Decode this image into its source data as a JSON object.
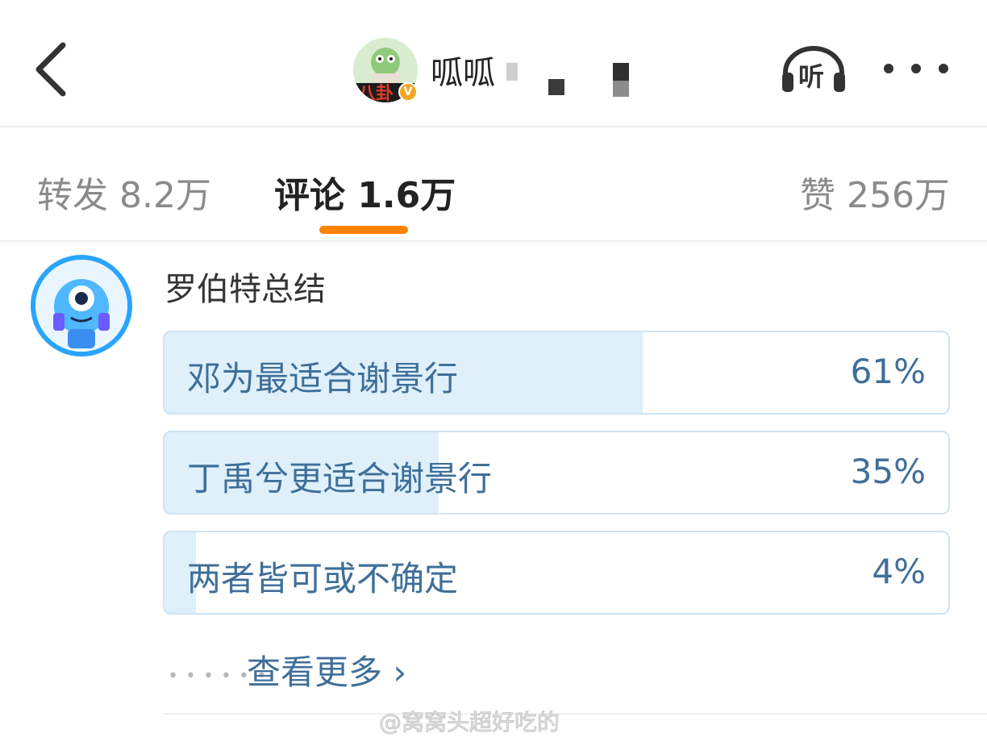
{
  "header": {
    "username": "呱呱",
    "verified_badge": "V",
    "listen_label": "听",
    "icons": {
      "back": "back-chevron-icon",
      "listen": "headphones-icon",
      "more": "more-dots-icon"
    }
  },
  "tabs": [
    {
      "label": "转发 8.2万",
      "active": false
    },
    {
      "label": "评论 1.6万",
      "active": true
    },
    {
      "label": "赞 256万",
      "active": false
    }
  ],
  "accent_color": "#ff8200",
  "comment": {
    "author": "罗伯特总结",
    "poll": {
      "options": [
        {
          "label": "邓为最适合谢景行",
          "percent_text": "61%",
          "percent": 61
        },
        {
          "label": "丁禹兮更适合谢景行",
          "percent_text": "35%",
          "percent": 35
        },
        {
          "label": "两者皆可或不确定",
          "percent_text": "4%",
          "percent": 4
        }
      ]
    },
    "see_more": "查看更多"
  },
  "watermark": "@窝窝头超好吃的",
  "colors": {
    "poll_text": "#3f6f99",
    "poll_fill": "#dff0fb",
    "poll_border": "#cfe3f3"
  }
}
